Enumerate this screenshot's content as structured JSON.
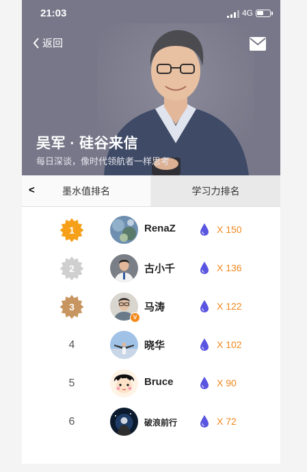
{
  "status": {
    "time": "21:03",
    "network": "4G",
    "battery_level": 0.55
  },
  "nav": {
    "back_label": "返回"
  },
  "hero": {
    "title": "吴军 · 硅谷来信",
    "subtitle": "每日深谈，像时代领航者一样思考"
  },
  "tabs": {
    "prev": "<",
    "active_label": "墨水值排名",
    "inactive_label": "学习力排名"
  },
  "colors": {
    "gold": "#f6a019",
    "silver": "#cfcfcf",
    "bronze": "#c79560",
    "accent": "#f0861c",
    "drop": "#5a55e0"
  },
  "ranking": [
    {
      "rank": "1",
      "name": "RenaZ",
      "score": "X 150",
      "medal": "gold",
      "avatar": "lily-pond-painting"
    },
    {
      "rank": "2",
      "name": "古小千",
      "score": "X 136",
      "medal": "silver",
      "avatar": "man-in-white-coat"
    },
    {
      "rank": "3",
      "name": "马涛",
      "score": "X 122",
      "medal": "bronze",
      "avatar": "man-with-glasses",
      "verified": "V"
    },
    {
      "rank": "4",
      "name": "晓华",
      "score": "X 102",
      "avatar": "person-sky"
    },
    {
      "rank": "5",
      "name": "Bruce",
      "score": "X 90",
      "avatar": "cartoon-boy"
    },
    {
      "rank": "6",
      "name": "破浪前行",
      "score": "X 72",
      "avatar": "dark-space-figure"
    }
  ]
}
